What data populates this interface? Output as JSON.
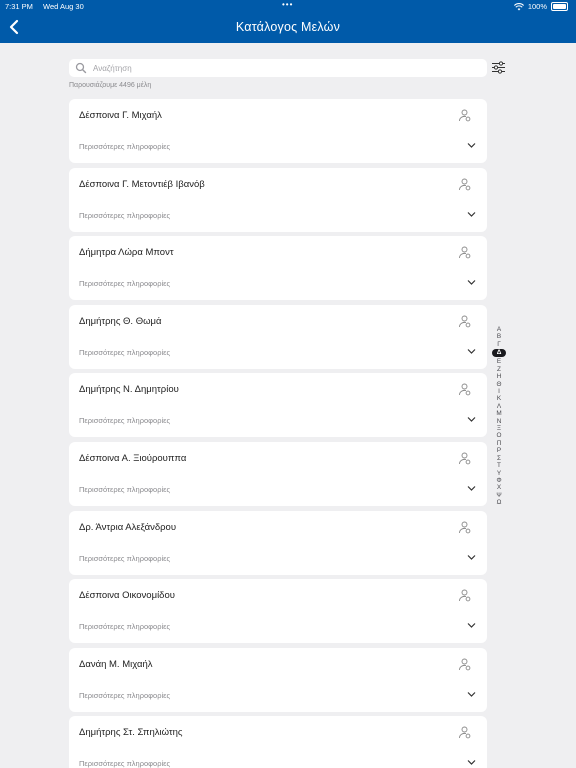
{
  "status_bar": {
    "time": "7:31 PM",
    "date": "Wed Aug 30",
    "battery": "100%"
  },
  "header": {
    "title": "Κατάλογος Μελών"
  },
  "search": {
    "placeholder": "Αναζήτηση"
  },
  "count_text": "Παρουσιάζουμε 4496 μέλη",
  "more_label": "Περισσότερες πληροφορίες",
  "members": [
    {
      "name": "Δέσποινα Γ. Μιχαήλ"
    },
    {
      "name": "Δέσποινα Γ. Μετοντιέβ Ιβανόβ"
    },
    {
      "name": "Δήμητρα Λώρα Μποντ"
    },
    {
      "name": "Δημήτρης Θ. Θωμά"
    },
    {
      "name": "Δημήτρης Ν. Δημητρίου"
    },
    {
      "name": "Δέσποινα Α. Ξιούρουππα"
    },
    {
      "name": "Δρ. Άντρια Αλεξάνδρου"
    },
    {
      "name": "Δέσποινα Οικονομίδου"
    },
    {
      "name": "Δανάη Μ. Μιχαήλ"
    },
    {
      "name": "Δημήτρης Στ. Σπηλιώτης"
    }
  ],
  "alphabet": [
    "Α",
    "Β",
    "Γ",
    "Δ",
    "Ε",
    "Ζ",
    "Η",
    "Θ",
    "Ι",
    "Κ",
    "Λ",
    "Μ",
    "Ν",
    "Ξ",
    "Ο",
    "Π",
    "Ρ",
    "Σ",
    "Τ",
    "Υ",
    "Φ",
    "Χ",
    "Ψ",
    "Ω"
  ],
  "active_letter": "Δ"
}
